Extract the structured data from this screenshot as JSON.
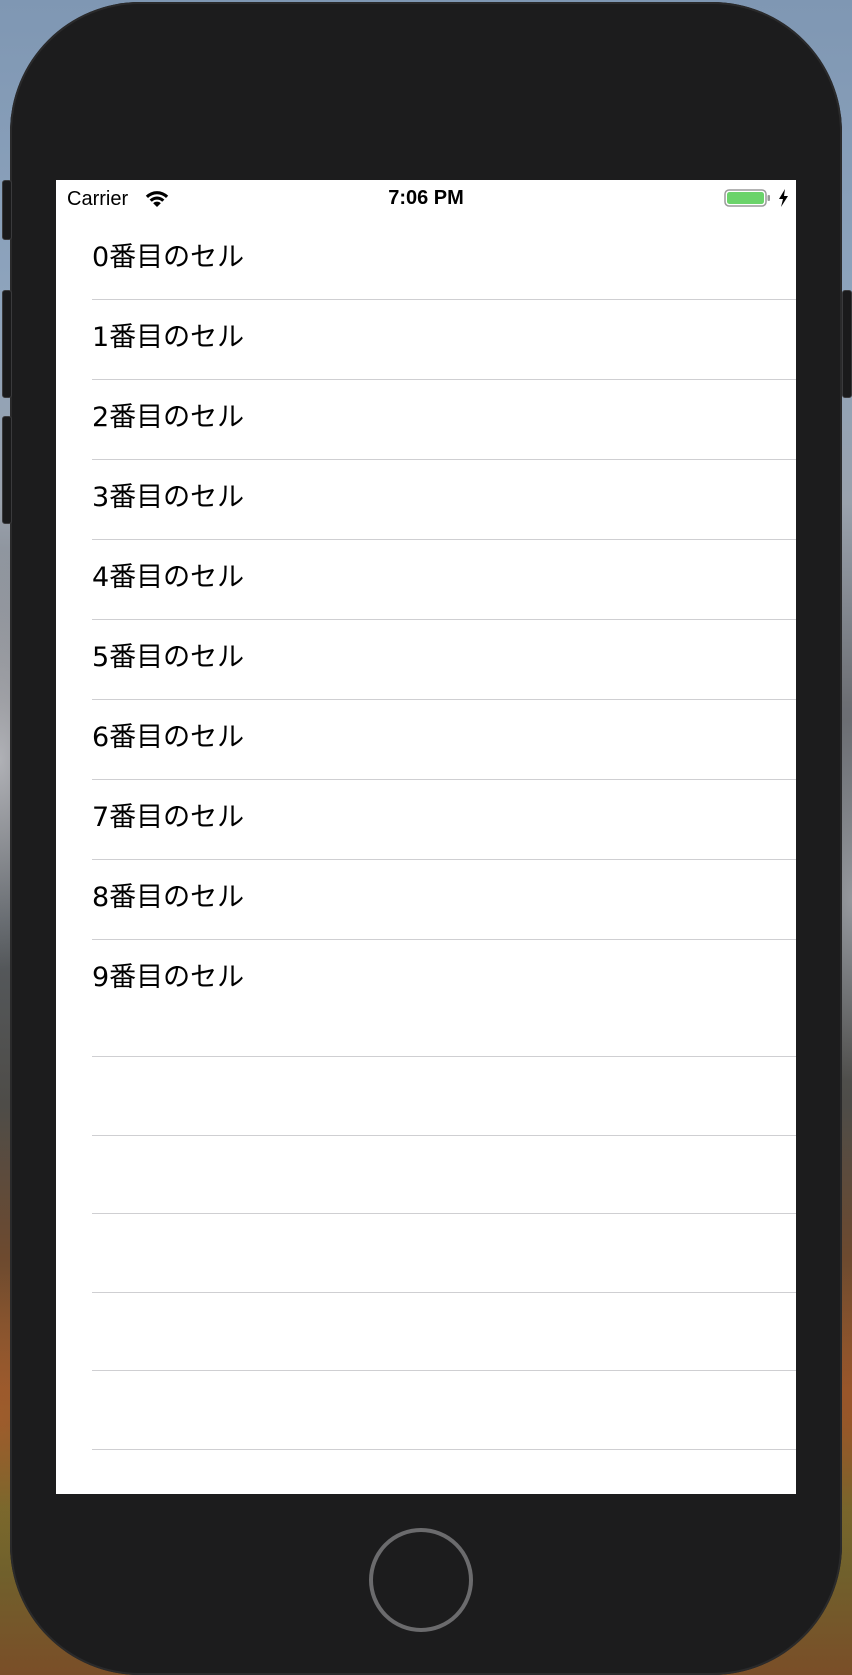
{
  "status_bar": {
    "carrier": "Carrier",
    "time": "7:06 PM",
    "battery_color": "#6bd36a"
  },
  "table": {
    "cells": [
      {
        "label": "0番目のセル"
      },
      {
        "label": "1番目のセル"
      },
      {
        "label": "2番目のセル"
      },
      {
        "label": "3番目のセル"
      },
      {
        "label": "4番目のセル"
      },
      {
        "label": "5番目のセル"
      },
      {
        "label": "6番目のセル"
      },
      {
        "label": "7番目のセル"
      },
      {
        "label": "8番目のセル"
      },
      {
        "label": "9番目のセル"
      }
    ],
    "empty_rows": 5
  },
  "icons": {
    "wifi": "wifi-icon",
    "battery": "battery-icon",
    "charging": "charging-bolt-icon",
    "home": "home-button"
  }
}
